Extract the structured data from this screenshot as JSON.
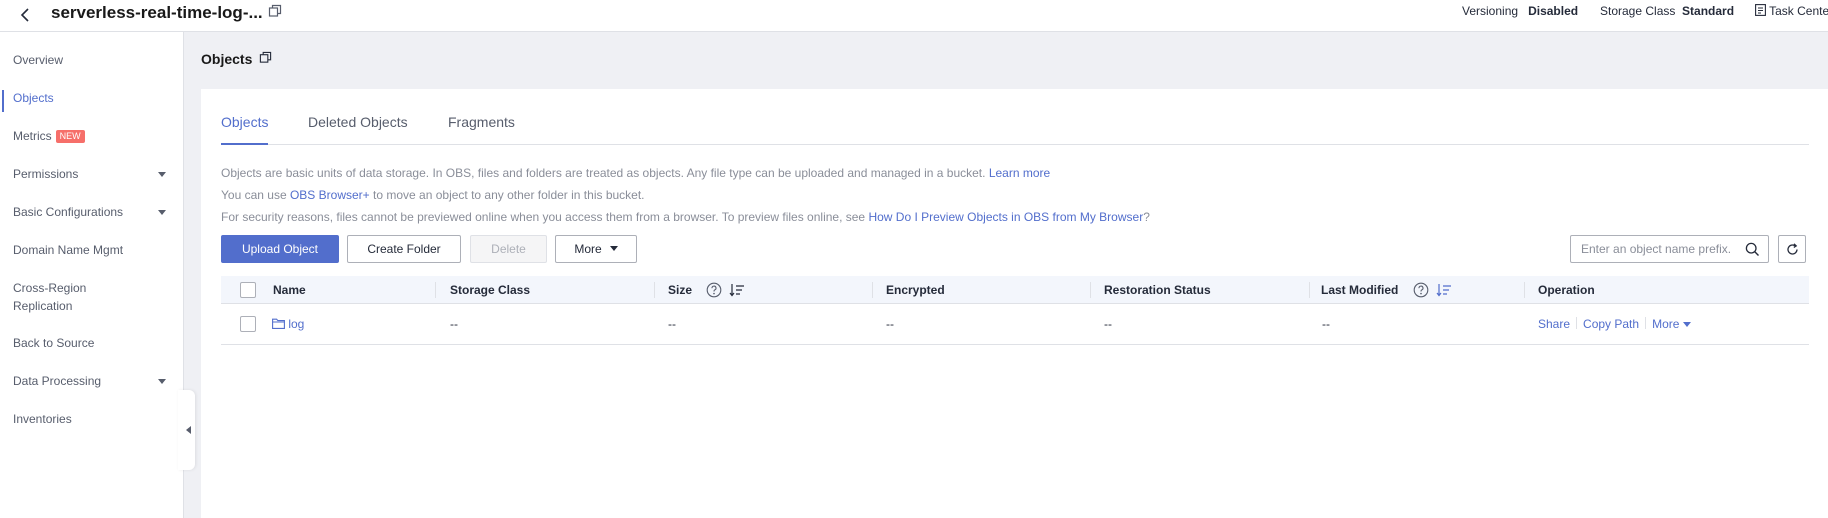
{
  "header": {
    "bucket_name": "serverless-real-time-log-...",
    "versioning_label": "Versioning",
    "versioning_value": "Disabled",
    "storage_class_label": "Storage Class",
    "storage_class_value": "Standard",
    "task_center_label": "Task Cente"
  },
  "sidebar": {
    "items": [
      {
        "label": "Overview"
      },
      {
        "label": "Objects"
      },
      {
        "label": "Metrics",
        "badge": "NEW"
      },
      {
        "label": "Permissions"
      },
      {
        "label": "Basic Configurations"
      },
      {
        "label": "Domain Name Mgmt"
      },
      {
        "label": "Cross-Region"
      },
      {
        "label": "Replication"
      },
      {
        "label": "Back to Source"
      },
      {
        "label": "Data Processing"
      },
      {
        "label": "Inventories"
      }
    ]
  },
  "main": {
    "title": "Objects",
    "tabs": [
      {
        "label": "Objects"
      },
      {
        "label": "Deleted Objects"
      },
      {
        "label": "Fragments"
      }
    ],
    "info": {
      "line1_text": "Objects are basic units of data storage. In OBS, files and folders are treated as objects. Any file type can be uploaded and managed in a bucket.",
      "line1_link": "Learn more",
      "line2_pre": "You can use",
      "line2_link": "OBS Browser+",
      "line2_post": "to move an object to any other folder in this bucket.",
      "line3_pre": "For security reasons, files cannot be previewed online when you access them from a browser. To preview files online, see",
      "line3_link": "How Do I Preview Objects in OBS from My Browser",
      "line3_post": "?"
    },
    "toolbar": {
      "upload_label": "Upload Object",
      "create_folder_label": "Create Folder",
      "delete_label": "Delete",
      "more_label": "More",
      "search_placeholder": "Enter an object name prefix."
    },
    "table": {
      "columns": [
        "Name",
        "Storage Class",
        "Size",
        "Encrypted",
        "Restoration Status",
        "Last Modified",
        "Operation"
      ],
      "rows": [
        {
          "name": "log",
          "storage_class": "--",
          "size": "--",
          "encrypted": "--",
          "restoration_status": "--",
          "last_modified": "--",
          "ops": [
            "Share",
            "Copy Path",
            "More"
          ]
        }
      ]
    }
  },
  "colors": {
    "accent": "#526ecc",
    "badge": "#f66f6a",
    "page_bg": "#eff0f4"
  }
}
